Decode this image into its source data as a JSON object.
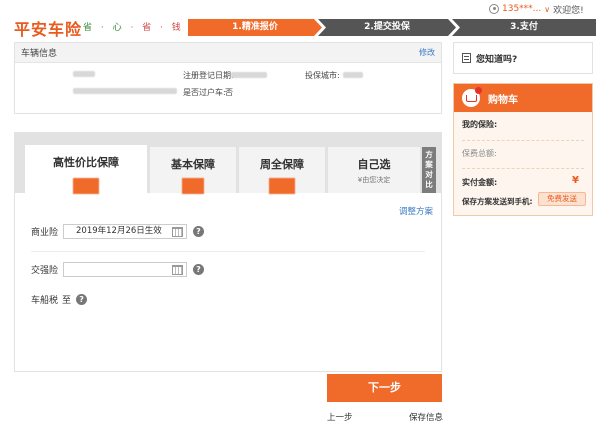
{
  "brand": {
    "logo": "平安车险",
    "slogan_a": "省 · 心",
    "slogan_b": " · 省 · 钱"
  },
  "user": {
    "phone": "135***...",
    "welcome": "欢迎您!"
  },
  "steps": [
    "1.精准报价",
    "2.提交投保",
    "3.支付"
  ],
  "vehicle": {
    "title": "车辆信息",
    "edit": "修改",
    "reg_date_label": "注册登记日期:",
    "city_label": "投保城市:",
    "transfer_label": "是否过户车:",
    "transfer_value": "否"
  },
  "know": {
    "title": "您知道吗?"
  },
  "cart": {
    "title": "购物车",
    "my_insurance": "我的保险:",
    "total_label": "保费总额:",
    "paid_label": "实付金额:",
    "currency": "¥",
    "send_label": "保存方案发送到手机:",
    "send_button": "免费发送"
  },
  "plan": {
    "tabs": [
      {
        "label": "高性价比保障"
      },
      {
        "label": "基本保障"
      },
      {
        "label": "周全保障"
      },
      {
        "label": "自己选",
        "sub": "¥由您决定"
      }
    ],
    "active_tab": 0,
    "compare": "方案对比",
    "adjust": "调整方案",
    "commercial_label": "商业险",
    "commercial_date": "2019年12月26日生效",
    "compulsory_label": "交强险",
    "compulsory_date": "",
    "tax_label": "车船税",
    "tax_value": "至",
    "help": "?"
  },
  "actions": {
    "next": "下一步",
    "prev": "上一步",
    "save": "保存信息"
  }
}
